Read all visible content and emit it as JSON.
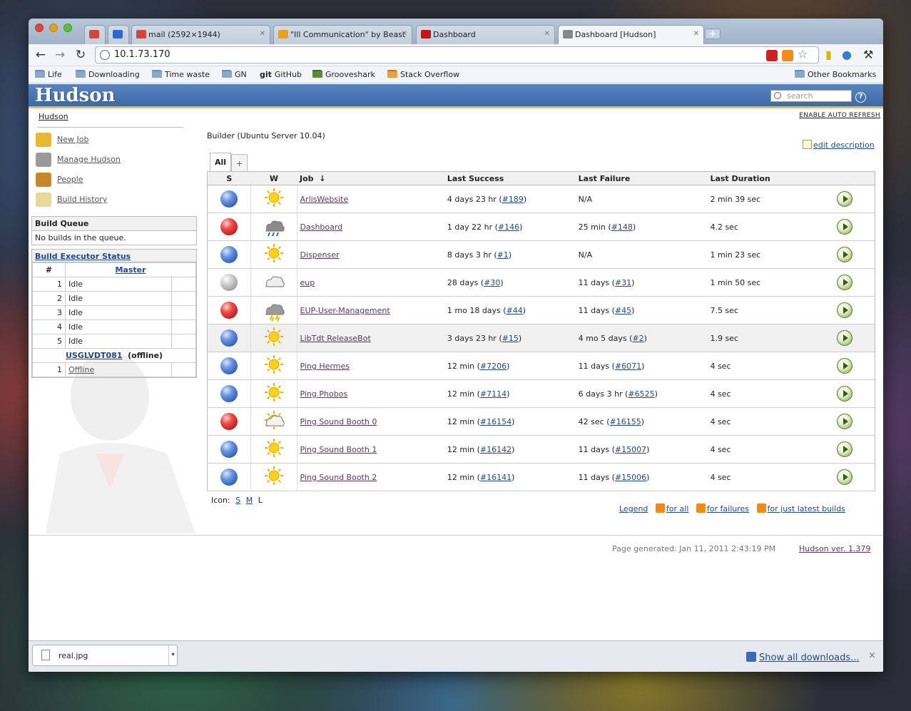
{
  "browser": {
    "tabs": [
      {
        "label": "",
        "icon": "gmail-icon",
        "color": "#d44638"
      },
      {
        "label": "",
        "icon": "calendar-icon",
        "color": "#2a6ad0"
      },
      {
        "label": "mail (2592×1944)",
        "icon": "gmail-icon",
        "color": "#d44638"
      },
      {
        "label": "\"Ill Communication\" by Beast",
        "icon": "music-icon",
        "color": "#e8a020"
      },
      {
        "label": "Dashboard",
        "icon": "red-square-icon",
        "color": "#c01818"
      },
      {
        "label": "Dashboard [Hudson]",
        "icon": "butler-icon",
        "color": "#888888"
      }
    ],
    "url": "10.1.73.170",
    "bookmarks": [
      "Life",
      "Downloading",
      "Time waste",
      "GN",
      "GitHub",
      "Grooveshark",
      "Stack Overflow"
    ],
    "other_bookmarks": "Other Bookmarks",
    "github_prefix": "git"
  },
  "hudson": {
    "logo": "Hudson",
    "search_placeholder": "search",
    "breadcrumb": "Hudson",
    "auto_refresh": "ENABLE AUTO REFRESH",
    "tasks": [
      {
        "label": "New Job",
        "icon": "new-job-icon",
        "color": "#e8b830"
      },
      {
        "label": "Manage Hudson",
        "icon": "manage-icon",
        "color": "#888888"
      },
      {
        "label": "People",
        "icon": "people-icon",
        "color": "#c8882a"
      },
      {
        "label": "Build History",
        "icon": "history-icon",
        "color": "#e8d898"
      }
    ],
    "build_queue": {
      "title": "Build Queue",
      "empty": "No builds in the queue."
    },
    "executor": {
      "title": "Build Executor Status",
      "col_num": "#",
      "master": "Master",
      "master_rows": [
        {
          "n": "1",
          "state": "Idle"
        },
        {
          "n": "2",
          "state": "Idle"
        },
        {
          "n": "3",
          "state": "Idle"
        },
        {
          "n": "4",
          "state": "Idle"
        },
        {
          "n": "5",
          "state": "Idle"
        }
      ],
      "slave": "USGLVDT081",
      "slave_status": "(offline)",
      "slave_rows": [
        {
          "n": "1",
          "state": "Offline"
        }
      ]
    },
    "description": "Builder (Ubuntu Server 10.04)",
    "edit_description": "edit description",
    "view_tabs": {
      "all": "All",
      "add": "+"
    },
    "columns": {
      "s": "S",
      "w": "W",
      "job": "Job",
      "sort": "↓",
      "last_success": "Last Success",
      "last_failure": "Last Failure",
      "last_duration": "Last Duration"
    },
    "jobs": [
      {
        "status": "blue",
        "weather": "sunny",
        "name": "ArlisWebsite",
        "ls": "4 days 23 hr (",
        "ls_build": "#189",
        "lf": "N/A",
        "lf_build": "",
        "dur": "2 min 39 sec"
      },
      {
        "status": "red",
        "weather": "storm",
        "name": "Dashboard",
        "ls": "1 day 22 hr (",
        "ls_build": "#146",
        "lf": "25 min (",
        "lf_build": "#148",
        "dur": "4.2 sec"
      },
      {
        "status": "blue",
        "weather": "sunny",
        "name": "Dispenser",
        "ls": "8 days 3 hr (",
        "ls_build": "#1",
        "lf": "N/A",
        "lf_build": "",
        "dur": "1 min 23 sec"
      },
      {
        "status": "grey",
        "weather": "cloudy",
        "name": "eup",
        "ls": "28 days (",
        "ls_build": "#30",
        "lf": "11 days (",
        "lf_build": "#31",
        "dur": "1 min 50 sec"
      },
      {
        "status": "red",
        "weather": "thunder",
        "name": "EUP-User-Management",
        "ls": "1 mo 18 days (",
        "ls_build": "#44",
        "lf": "11 days (",
        "lf_build": "#45",
        "dur": "7.5 sec"
      },
      {
        "status": "blue",
        "weather": "sunny",
        "name": "LibTdt ReleaseBot",
        "ls": "3 days 23 hr (",
        "ls_build": "#15",
        "lf": "4 mo 5 days (",
        "lf_build": "#2",
        "dur": "1.9 sec",
        "highlight": true
      },
      {
        "status": "blue",
        "weather": "sunny",
        "name": "Ping Hermes",
        "ls": "12 min (",
        "ls_build": "#7206",
        "lf": "11 days (",
        "lf_build": "#6071",
        "dur": "4 sec"
      },
      {
        "status": "blue",
        "weather": "sunny",
        "name": "Ping Phobos",
        "ls": "12 min (",
        "ls_build": "#7114",
        "lf": "6 days 3 hr (",
        "lf_build": "#6525",
        "dur": "4 sec"
      },
      {
        "status": "red",
        "weather": "partly-cloudy",
        "name": "Ping Sound Booth 0",
        "ls": "12 min (",
        "ls_build": "#16154",
        "lf": "42 sec (",
        "lf_build": "#16155",
        "dur": "4 sec"
      },
      {
        "status": "blue",
        "weather": "sunny",
        "name": "Ping Sound Booth 1",
        "ls": "12 min (",
        "ls_build": "#16142",
        "lf": "11 days (",
        "lf_build": "#15007",
        "dur": "4 sec"
      },
      {
        "status": "blue",
        "weather": "sunny",
        "name": "Ping Sound Booth 2",
        "ls": "12 min (",
        "ls_build": "#16141",
        "lf": "11 days (",
        "lf_build": "#15006",
        "dur": "4 sec"
      }
    ],
    "icon_size": {
      "label": "Icon:",
      "s": "S",
      "m": "M",
      "l": "L"
    },
    "rss": {
      "legend": "Legend",
      "all": "for all",
      "failures": "for failures",
      "latest": "for just latest builds"
    },
    "page_generated": "Page generated: Jan 11, 2011 2:43:19 PM",
    "version": "Hudson ver. 1.379"
  },
  "downloads": {
    "file": "real.jpg",
    "show_all": "Show all downloads...",
    "close": "×"
  }
}
